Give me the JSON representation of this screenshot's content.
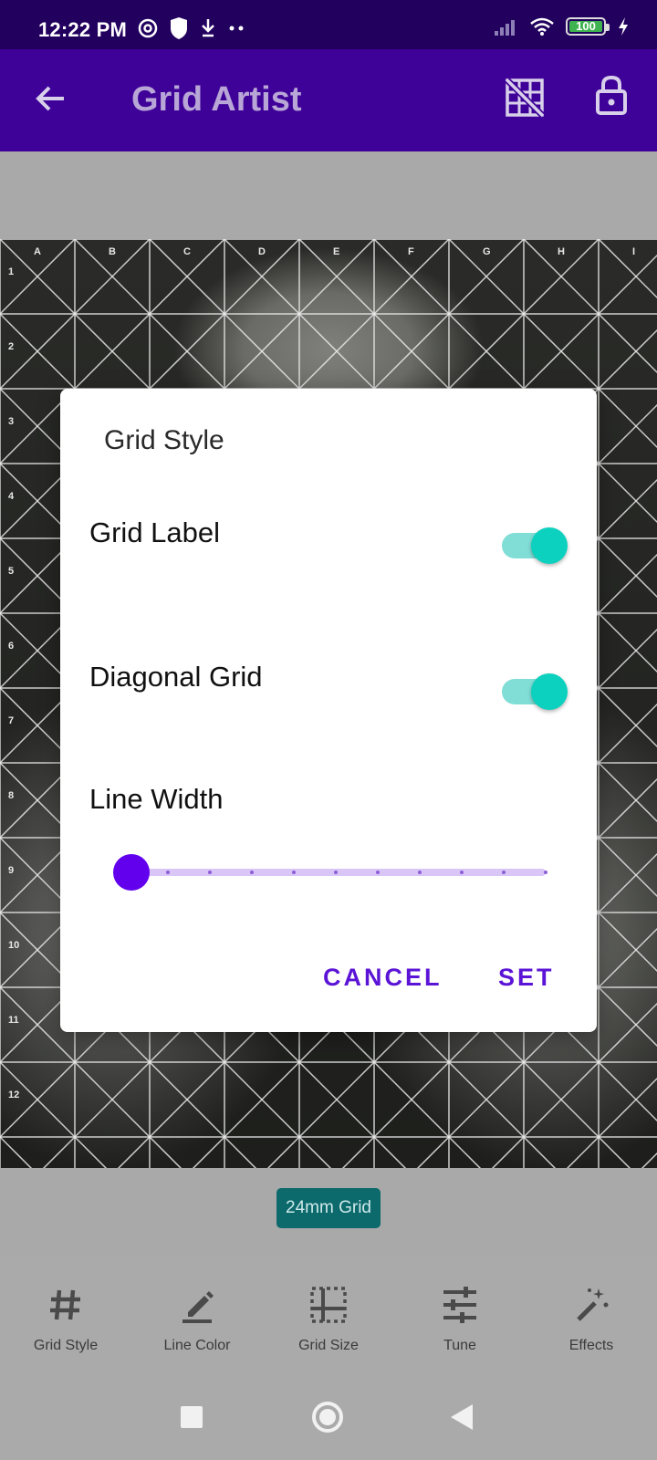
{
  "status_bar": {
    "time": "12:22 PM",
    "battery": "100",
    "icons": [
      "at-icon",
      "shield-icon",
      "download-icon",
      "dots-icon",
      "signal-icon",
      "wifi-icon",
      "battery-icon",
      "charging-icon"
    ]
  },
  "app_bar": {
    "title": "Grid Artist",
    "icons": [
      "back-arrow-icon",
      "grid-off-icon",
      "lock-icon"
    ]
  },
  "grid": {
    "columns": [
      "A",
      "B",
      "C",
      "D",
      "E",
      "F",
      "G",
      "H",
      "I"
    ],
    "rows": [
      "1",
      "2",
      "3",
      "4",
      "5",
      "6",
      "7",
      "8",
      "9",
      "10",
      "11",
      "12"
    ]
  },
  "grid_badge": "24mm Grid",
  "dialog": {
    "title": "Grid Style",
    "grid_label": {
      "label": "Grid Label",
      "on": true
    },
    "diagonal_grid": {
      "label": "Diagonal Grid",
      "on": true
    },
    "line_width": {
      "label": "Line Width",
      "value": 1,
      "min": 1,
      "max": 11
    },
    "cancel_label": "CANCEL",
    "set_label": "SET"
  },
  "toolbar": {
    "items": [
      {
        "label": "Grid Style",
        "icon": "hash-icon"
      },
      {
        "label": "Line Color",
        "icon": "pencil-icon"
      },
      {
        "label": "Grid Size",
        "icon": "grid-size-icon"
      },
      {
        "label": "Tune",
        "icon": "tune-icon"
      },
      {
        "label": "Effects",
        "icon": "magic-wand-icon"
      }
    ]
  },
  "colors": {
    "status_bar": "#22005e",
    "app_bar": "#3f0299",
    "accent": "#6200ee",
    "switch": "#0bd1be",
    "badge": "#0c6a6c"
  }
}
